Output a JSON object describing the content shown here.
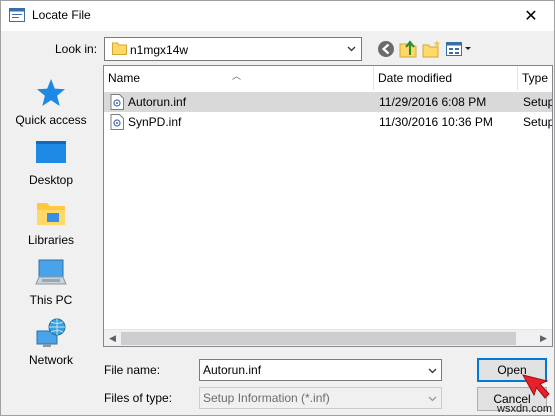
{
  "window": {
    "title": "Locate File",
    "close_glyph": "✕"
  },
  "lookin": {
    "label": "Look in:",
    "value": "n1mgx14w"
  },
  "places": [
    {
      "label": "Quick access",
      "icon": "star-icon"
    },
    {
      "label": "Desktop",
      "icon": "desktop-icon"
    },
    {
      "label": "Libraries",
      "icon": "libraries-icon"
    },
    {
      "label": "This PC",
      "icon": "computer-icon"
    },
    {
      "label": "Network",
      "icon": "network-icon"
    }
  ],
  "columns": {
    "name": "Name",
    "date": "Date modified",
    "type": "Type"
  },
  "files": [
    {
      "name": "Autorun.inf",
      "date": "11/29/2016 6:08 PM",
      "type": "Setup",
      "selected": true
    },
    {
      "name": "SynPD.inf",
      "date": "11/30/2016 10:36 PM",
      "type": "Setup",
      "selected": false
    }
  ],
  "filename": {
    "label": "File name:",
    "value": "Autorun.inf"
  },
  "filetype": {
    "label": "Files of type:",
    "value": "Setup Information (*.inf)"
  },
  "buttons": {
    "open": "Open",
    "cancel": "Cancel"
  },
  "watermark": "wsxdn.com",
  "colors": {
    "accent": "#0078d7",
    "selection": "#d9d9d9",
    "cursor": "#e8202a"
  }
}
